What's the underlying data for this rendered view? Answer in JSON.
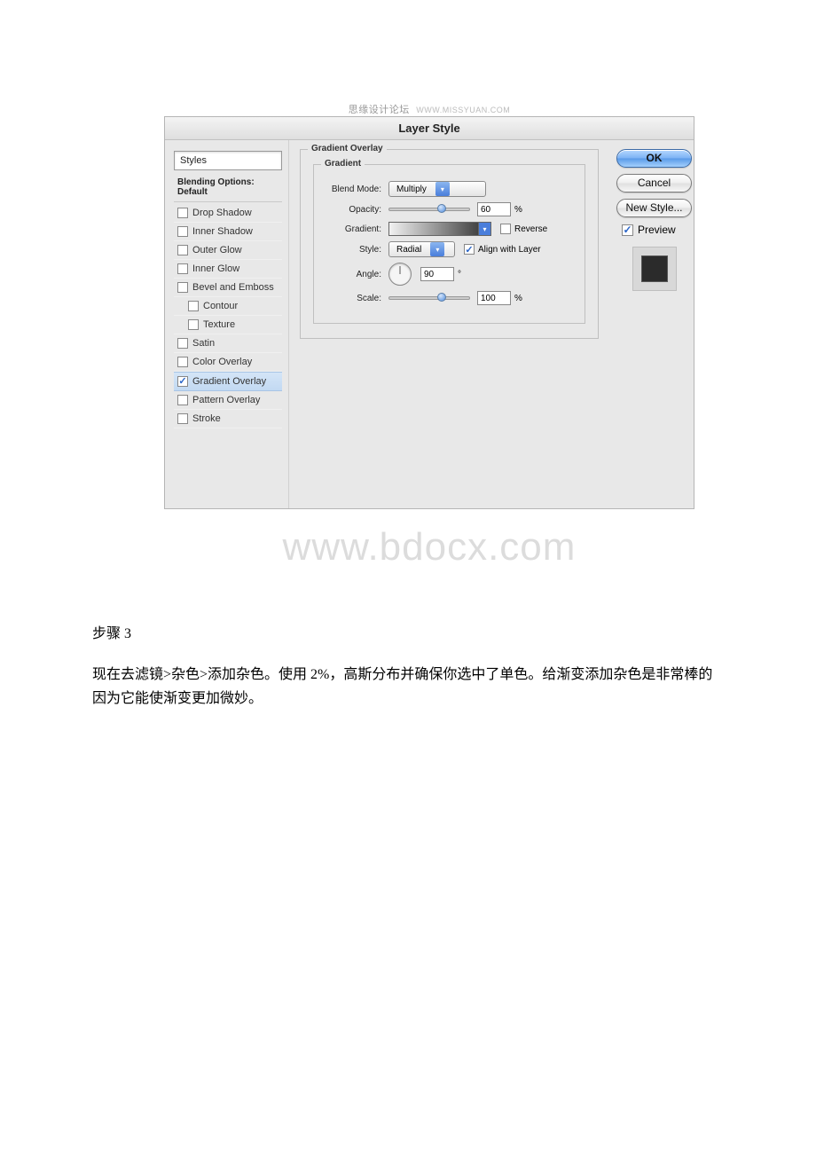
{
  "header": {
    "cn": "思缘设计论坛",
    "en": "WWW.MISSYUAN.COM"
  },
  "dialog": {
    "title": "Layer Style",
    "sidebar": {
      "styles_label": "Styles",
      "blending_label": "Blending Options: Default",
      "effects": [
        {
          "label": "Drop Shadow",
          "checked": false,
          "selected": false,
          "indent": false
        },
        {
          "label": "Inner Shadow",
          "checked": false,
          "selected": false,
          "indent": false
        },
        {
          "label": "Outer Glow",
          "checked": false,
          "selected": false,
          "indent": false
        },
        {
          "label": "Inner Glow",
          "checked": false,
          "selected": false,
          "indent": false
        },
        {
          "label": "Bevel and Emboss",
          "checked": false,
          "selected": false,
          "indent": false
        },
        {
          "label": "Contour",
          "checked": false,
          "selected": false,
          "indent": true
        },
        {
          "label": "Texture",
          "checked": false,
          "selected": false,
          "indent": true
        },
        {
          "label": "Satin",
          "checked": false,
          "selected": false,
          "indent": false
        },
        {
          "label": "Color Overlay",
          "checked": false,
          "selected": false,
          "indent": false
        },
        {
          "label": "Gradient Overlay",
          "checked": true,
          "selected": true,
          "indent": false
        },
        {
          "label": "Pattern Overlay",
          "checked": false,
          "selected": false,
          "indent": false
        },
        {
          "label": "Stroke",
          "checked": false,
          "selected": false,
          "indent": false
        }
      ]
    },
    "panel": {
      "section_title": "Gradient Overlay",
      "subsection_title": "Gradient",
      "blend_mode_label": "Blend Mode:",
      "blend_mode_value": "Multiply",
      "opacity_label": "Opacity:",
      "opacity_value": "60",
      "opacity_unit": "%",
      "gradient_label": "Gradient:",
      "reverse_label": "Reverse",
      "reverse_checked": false,
      "style_label": "Style:",
      "style_value": "Radial",
      "align_label": "Align with Layer",
      "align_checked": true,
      "angle_label": "Angle:",
      "angle_value": "90",
      "angle_unit": "°",
      "scale_label": "Scale:",
      "scale_value": "100",
      "scale_unit": "%"
    },
    "buttons": {
      "ok": "OK",
      "cancel": "Cancel",
      "new_style": "New Style...",
      "preview_label": "Preview",
      "preview_checked": true
    }
  },
  "watermark": "www.bdocx.com",
  "article": {
    "step_title": "步骤 3",
    "body": "现在去滤镜>杂色>添加杂色。使用 2%，高斯分布并确保你选中了单色。给渐变添加杂色是非常棒的因为它能使渐变更加微妙。"
  }
}
